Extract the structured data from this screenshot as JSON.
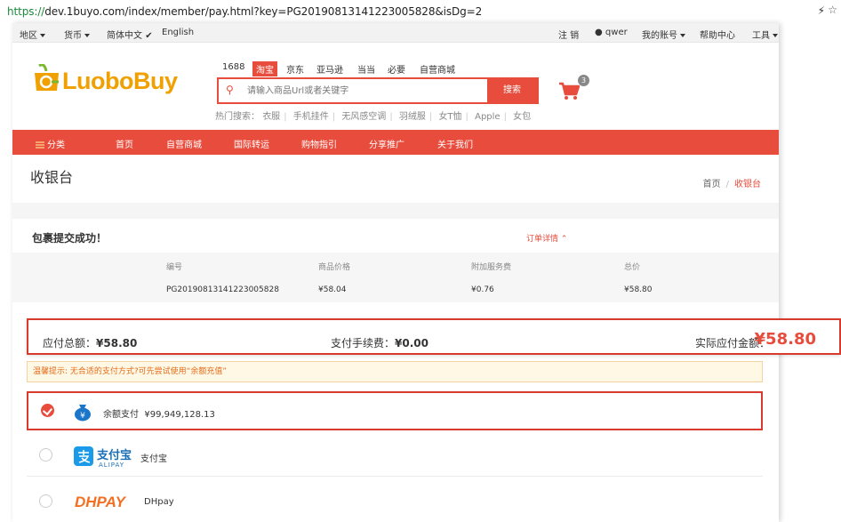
{
  "browser": {
    "url_scheme": "https://",
    "url_rest": "dev.1buyo.com/index/member/pay.html?key=PG20190813141223005828&isDg=2"
  },
  "topbar": {
    "region": "地区",
    "currency": "货币",
    "lang_cn": "简体中文",
    "lang_en": "English",
    "logout": "注 销",
    "user": "qwer",
    "account": "我的账号",
    "help": "帮助中心",
    "tools": "工具"
  },
  "logo": {
    "part1": "LuoboBuy"
  },
  "search": {
    "tabs": [
      "1688",
      "淘宝",
      "京东",
      "亚马逊",
      "当当",
      "必要",
      "自营商城"
    ],
    "active_tab": "淘宝",
    "placeholder": "请输入商品Url或者关键字",
    "button": "搜索",
    "hot_label": "热门搜索：",
    "hot_words": [
      "衣服",
      "手机挂件",
      "无风感空调",
      "羽绒服",
      "女T恤",
      "Apple",
      "女包"
    ]
  },
  "cart": {
    "count": "3"
  },
  "nav": [
    "分类",
    "首页",
    "自营商城",
    "国际转运",
    "购物指引",
    "分享推广",
    "关于我们"
  ],
  "page": {
    "title": "收银台",
    "breadcrumb_home": "首页",
    "breadcrumb_sep": "/",
    "breadcrumb_current": "收银台"
  },
  "order": {
    "success_text": "包裹提交成功！",
    "detail_link": "订单详情",
    "headers": [
      "编号",
      "商品价格",
      "附加服务费",
      "总价"
    ],
    "values": [
      "PG20190813141223005828",
      "¥58.04",
      "¥0.76",
      "¥58.80"
    ]
  },
  "summary": {
    "total_label": "应付总额：",
    "total_value": "¥58.80",
    "fee_label": "支付手续费：",
    "fee_value": "¥0.00",
    "actual_label": "实际应付金额：",
    "actual_value": "¥58.80"
  },
  "tip": "温馨提示: 无合适的支付方式?可先尝试使用“余额充值”",
  "payments": [
    {
      "label": "余额支付",
      "amount": "¥99,949,128.13",
      "selected": true
    },
    {
      "label": "支付宝",
      "logo_cn": "支付宝",
      "logo_en": "ALIPAY",
      "selected": false
    },
    {
      "label": "DHpay",
      "logo": "DHPAY",
      "selected": false
    }
  ],
  "colors": {
    "brand_red": "#e74c3c",
    "logo_orange": "#f0a000",
    "logo_green": "#7cb82f"
  }
}
